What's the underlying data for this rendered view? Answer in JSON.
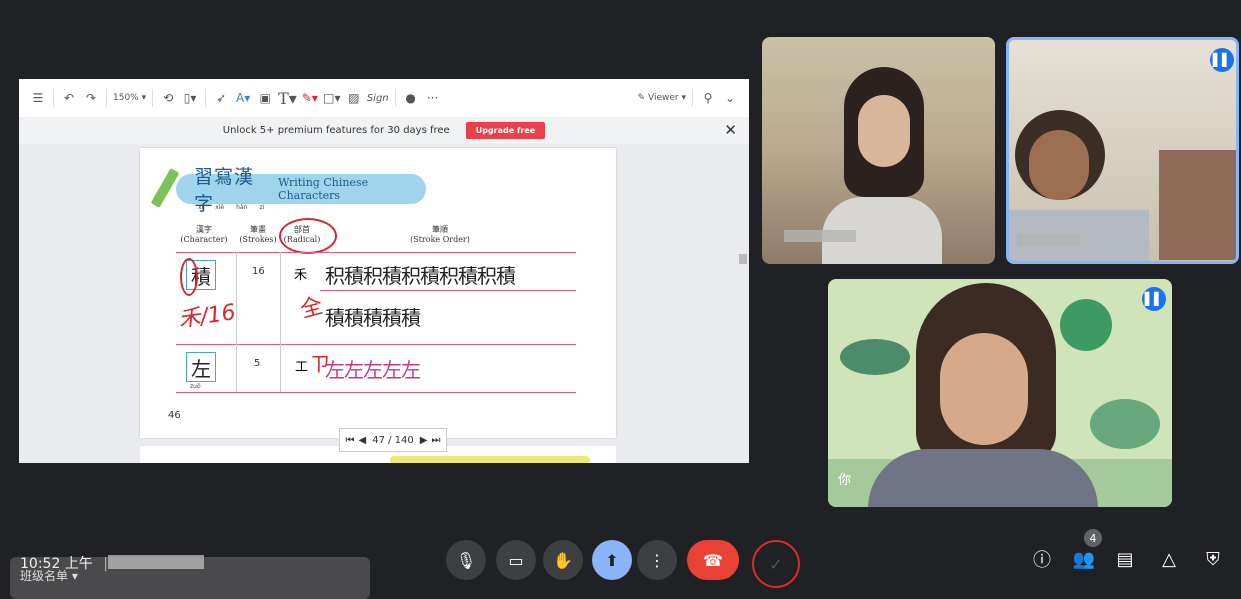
{
  "toolbar": {
    "zoom": "150% ▾",
    "sign_label": "Sign",
    "viewer_label": "Viewer ▾",
    "more": "···"
  },
  "banner": {
    "text": "Unlock 5+ premium features for 30 days free",
    "button": "Upgrade free",
    "close": "✕"
  },
  "document": {
    "title_han": "習寫漢字",
    "title_en": "Writing Chinese Characters",
    "pinyin": [
      "xí",
      "xiě",
      "hàn",
      "zì"
    ],
    "columns": [
      {
        "han": "漢字",
        "en": "(Character)"
      },
      {
        "han": "筆畫",
        "en": "(Strokes)"
      },
      {
        "han": "部首",
        "en": "(Radical)"
      },
      {
        "han": "筆順",
        "en": "(Stroke Order)"
      }
    ],
    "rows": [
      {
        "char": "積",
        "strokes": "16",
        "radical": "禾",
        "sequence1": "积積积積积積积積积積",
        "sequence2": "積積積積積",
        "annotation": "禾/16",
        "annotation2": "全"
      },
      {
        "char": "左",
        "strokes": "5",
        "radical": "工",
        "sequence1": "左左左左左",
        "pinyin": "zuǒ",
        "annotation": "ㄗ"
      }
    ],
    "page_number": "46",
    "pager": "47 / 140"
  },
  "participants": [
    {
      "name": "",
      "speaking": false
    },
    {
      "name": "",
      "speaking": true
    },
    {
      "name": "你",
      "speaking": true
    }
  ],
  "bottom": {
    "time": "10:52 上午",
    "separator": "|",
    "overlay_text": "班级名单 ▾",
    "people_count": "4"
  },
  "icons": {
    "mic": "mic-icon",
    "camera": "camera-icon",
    "hand": "raise-hand-icon",
    "present": "present-icon",
    "more": "more-vert-icon",
    "end": "end-call-icon",
    "check": "check-icon",
    "info": "info-icon",
    "people": "people-icon",
    "chat": "chat-icon",
    "activities": "activities-icon",
    "host": "host-controls-icon"
  },
  "colors": {
    "meet_bg": "#202124",
    "end_call": "#ea4335",
    "present_active": "#8ab4f8",
    "active_border": "#8ab4f8",
    "speaking_badge": "#1a73e8"
  }
}
